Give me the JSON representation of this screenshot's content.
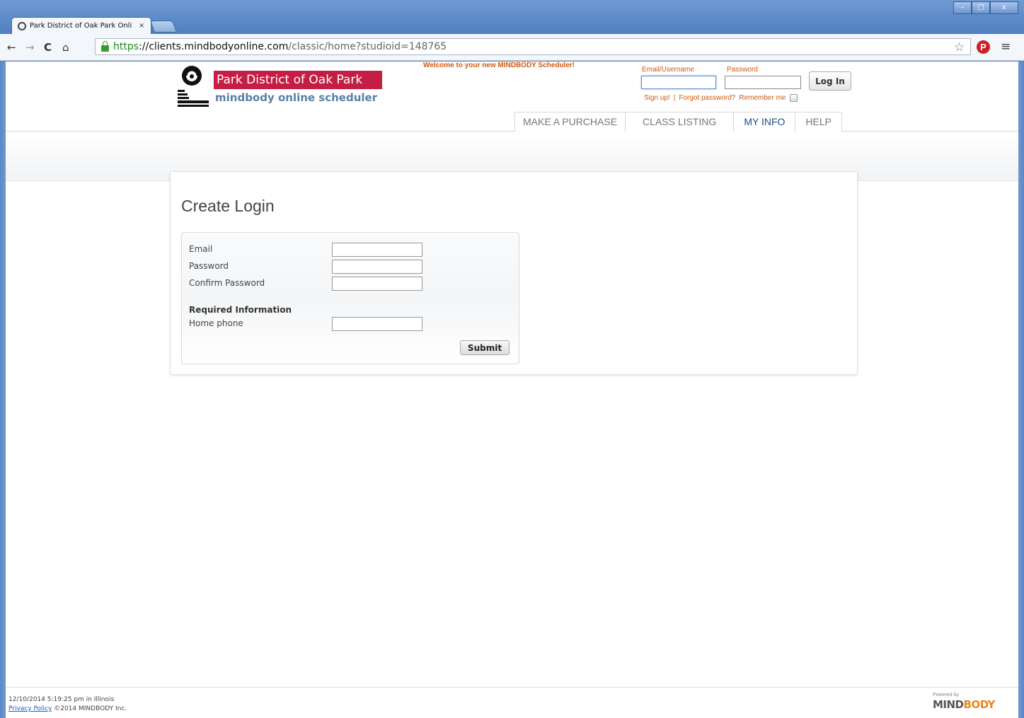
{
  "browser": {
    "tab_title": "Park District of Oak Park Onli",
    "tab_close": "×",
    "url_scheme": "https",
    "url_host": "://clients.mindbodyonline.com",
    "url_path": "/classic/home?studioid=148765",
    "icons": [
      "back-icon",
      "forward-icon",
      "reload-icon",
      "home-icon",
      "lock-icon",
      "star-icon",
      "pinterest-icon",
      "menu-icon"
    ],
    "window_controls": [
      "–",
      "□",
      "x"
    ]
  },
  "header": {
    "brand_name": "Park District of Oak Park",
    "brand_sub": "mindbody online scheduler",
    "welcome": "Welcome to your new MINDBODY Scheduler!",
    "login": {
      "email_label": "Email/Username",
      "password_label": "Password",
      "login_button": "Log In",
      "signup": "Sign up!",
      "separator": "|",
      "forgot": "Forgot password?",
      "remember": "Remember me"
    },
    "nav_tabs": [
      {
        "label": "MAKE A PURCHASE"
      },
      {
        "label": "CLASS LISTING"
      },
      {
        "label": "MY INFO",
        "active": true
      },
      {
        "label": "HELP"
      }
    ]
  },
  "form": {
    "title": "Create Login",
    "fields": [
      {
        "label": "Email",
        "value": ""
      },
      {
        "label": "Password",
        "value": ""
      },
      {
        "label": "Confirm Password",
        "value": ""
      }
    ],
    "required_title": "Required Information",
    "required_fields": [
      {
        "label": "Home phone",
        "value": ""
      }
    ],
    "submit_label": "Submit"
  },
  "footer": {
    "timestamp": "12/10/2014 5:19:25 pm in Illinois",
    "privacy": "Privacy Policy",
    "copyright": "©2014 MINDBODY Inc.",
    "powered_small": "Powered by",
    "powered_brand_1": "MIND",
    "powered_brand_2": "BODY"
  },
  "colors": {
    "brand_red": "#c41e45",
    "accent_orange": "#d0590f",
    "active_tab_blue": "#1d4d86",
    "browser_frame": "#5a88c6"
  }
}
